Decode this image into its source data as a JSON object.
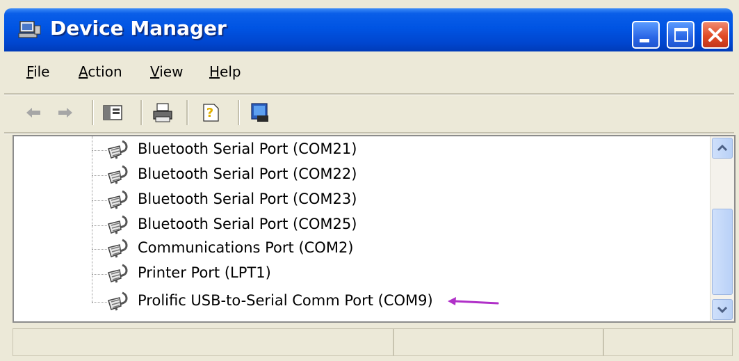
{
  "window": {
    "title": "Device Manager",
    "controls": [
      "minimize",
      "maximize",
      "close"
    ]
  },
  "menu": {
    "items": [
      {
        "label": "File",
        "mnemonic": "F"
      },
      {
        "label": "Action",
        "mnemonic": "A"
      },
      {
        "label": "View",
        "mnemonic": "V"
      },
      {
        "label": "Help",
        "mnemonic": "H"
      }
    ]
  },
  "toolbar": {
    "buttons": [
      {
        "icon": "back-arrow-icon"
      },
      {
        "icon": "forward-arrow-icon"
      },
      {
        "icon": "show-hide-console-tree-icon"
      },
      {
        "icon": "print-icon"
      },
      {
        "icon": "help-icon"
      },
      {
        "icon": "properties-icon"
      }
    ]
  },
  "tree": {
    "items": [
      {
        "label": "Bluetooth Serial Port (COM21)"
      },
      {
        "label": "Bluetooth Serial Port (COM22)"
      },
      {
        "label": "Bluetooth Serial Port (COM23)"
      },
      {
        "label": "Bluetooth Serial Port (COM25)"
      },
      {
        "label": "Communications Port (COM2)"
      },
      {
        "label": "Printer Port (LPT1)"
      },
      {
        "label": "Prolific USB-to-Serial Comm Port (COM9)"
      }
    ]
  },
  "annotation": {
    "color": "#b030c8"
  },
  "colors": {
    "titlebar": "#0054e3",
    "chrome": "#ece9d8",
    "close": "#e04b26"
  }
}
